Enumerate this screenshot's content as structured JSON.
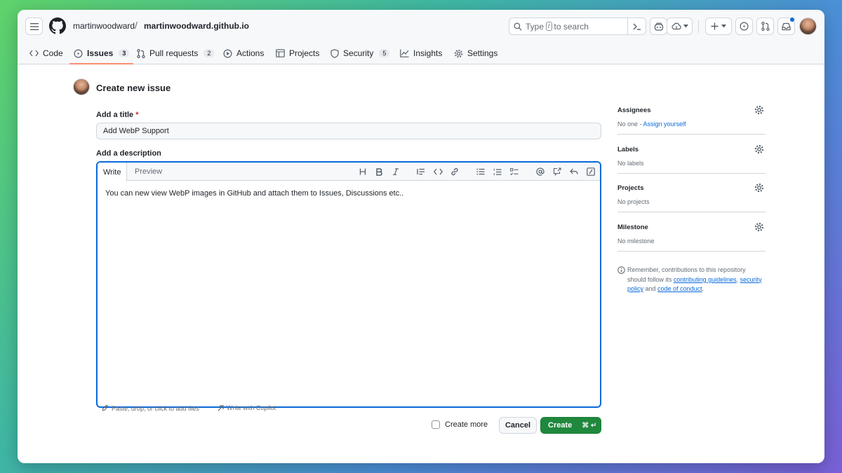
{
  "header": {
    "owner": "martinwoodward",
    "separator": "/",
    "repo": "martinwoodward.github.io",
    "search": {
      "type_label": "Type",
      "key": "/",
      "suffix": "to search"
    }
  },
  "tabs": [
    {
      "label": "Code",
      "icon": "code-icon"
    },
    {
      "label": "Issues",
      "count": "3",
      "icon": "issue-opened-icon"
    },
    {
      "label": "Pull requests",
      "count": "2",
      "icon": "pull-request-icon"
    },
    {
      "label": "Actions",
      "icon": "play-icon"
    },
    {
      "label": "Projects",
      "icon": "table-icon"
    },
    {
      "label": "Security",
      "count": "5",
      "icon": "shield-icon"
    },
    {
      "label": "Insights",
      "icon": "graph-icon"
    },
    {
      "label": "Settings",
      "icon": "gear-icon"
    }
  ],
  "form": {
    "page_title": "Create new issue",
    "title_label": "Add a title",
    "required_mark": "*",
    "title_value": "Add WebP Support",
    "desc_label": "Add a description",
    "write_tab": "Write",
    "preview_tab": "Preview",
    "body": "You can new view WebP images in GitHub and attach them to Issues, Discussions etc..",
    "paste_hint": "Paste, drop, or click to add files",
    "copilot_hint": "Write with Copilot",
    "create_more": "Create more",
    "cancel": "Cancel",
    "create": "Create",
    "create_shortcut": "⌘ ↵"
  },
  "sidebar": {
    "assignees": {
      "title": "Assignees",
      "value": "No one - ",
      "link": "Assign yourself"
    },
    "labels": {
      "title": "Labels",
      "value": "No labels"
    },
    "projects": {
      "title": "Projects",
      "value": "No projects"
    },
    "milestone": {
      "title": "Milestone",
      "value": "No milestone"
    },
    "note": {
      "part1": "Remember, contributions to this repository should follow its ",
      "link1": "contributing guidelines",
      "part2": ", ",
      "link2": "security policy",
      "part3": " and ",
      "link3": "code of conduct",
      "part4": "."
    }
  },
  "colors": {
    "accent": "#0969da",
    "create_green": "#1f883d",
    "active_tab_underline": "#fd8c73"
  }
}
